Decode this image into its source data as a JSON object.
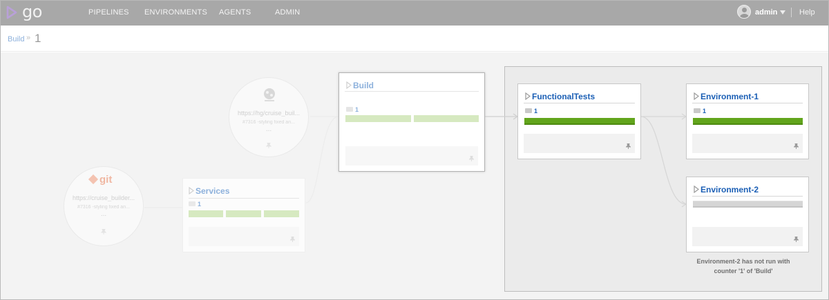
{
  "header": {
    "logo_text": "go",
    "nav": [
      "PIPELINES",
      "ENVIRONMENTS",
      "AGENTS",
      "ADMIN"
    ],
    "user": "admin",
    "help": "Help"
  },
  "breadcrumb": {
    "pipeline": "Build",
    "separator": "»",
    "counter": "1"
  },
  "materials": [
    {
      "type": "hg",
      "type_label": "",
      "url": "https://hg/cruise_buil...",
      "description": "#7316 -styling fixed an...",
      "more": "..."
    },
    {
      "type": "git",
      "type_label": "git",
      "url": "https://cruise_builder...",
      "description": "#7316 -styling fixed an...",
      "more": "..."
    }
  ],
  "pipelines": {
    "build": {
      "name": "Build",
      "counter": "1",
      "stages": [
        "passed",
        "passed"
      ]
    },
    "services": {
      "name": "Services",
      "counter": "1",
      "stages": [
        "passed",
        "passed",
        "passed"
      ]
    },
    "functional_tests": {
      "name": "FunctionalTests",
      "counter": "1",
      "stages": [
        "passed"
      ]
    },
    "environment_1": {
      "name": "Environment-1",
      "counter": "1",
      "stages": [
        "passed"
      ]
    },
    "environment_2": {
      "name": "Environment-2",
      "counter": "",
      "stages": [
        "not-run"
      ]
    }
  },
  "environment_note": "Environment-2 has not run with counter '1' of 'Build'",
  "colors": {
    "header_bg": "#a8a8a8",
    "link_blue": "#1b5fb5",
    "faded_link": "#8db1dc",
    "stage_passed": "#62a51c",
    "stage_passed_faded": "#d6e9c0",
    "stage_not_run": "#d5d5d5",
    "env_bg": "#ebebeb"
  }
}
